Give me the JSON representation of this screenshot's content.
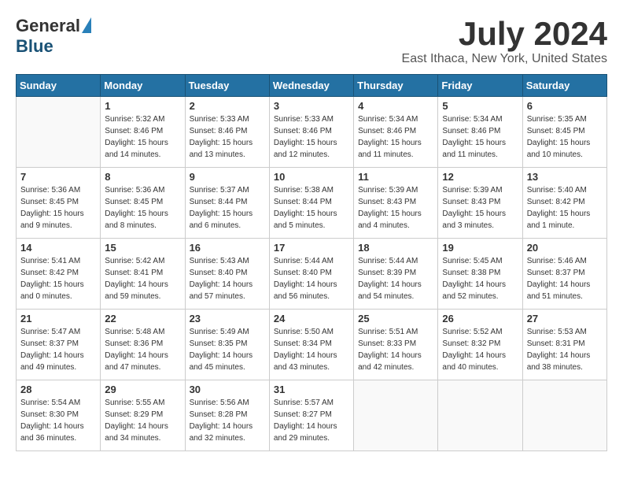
{
  "logo": {
    "general": "General",
    "blue": "Blue"
  },
  "title": "July 2024",
  "location": "East Ithaca, New York, United States",
  "headers": [
    "Sunday",
    "Monday",
    "Tuesday",
    "Wednesday",
    "Thursday",
    "Friday",
    "Saturday"
  ],
  "weeks": [
    [
      {
        "day": "",
        "info": ""
      },
      {
        "day": "1",
        "info": "Sunrise: 5:32 AM\nSunset: 8:46 PM\nDaylight: 15 hours\nand 14 minutes."
      },
      {
        "day": "2",
        "info": "Sunrise: 5:33 AM\nSunset: 8:46 PM\nDaylight: 15 hours\nand 13 minutes."
      },
      {
        "day": "3",
        "info": "Sunrise: 5:33 AM\nSunset: 8:46 PM\nDaylight: 15 hours\nand 12 minutes."
      },
      {
        "day": "4",
        "info": "Sunrise: 5:34 AM\nSunset: 8:46 PM\nDaylight: 15 hours\nand 11 minutes."
      },
      {
        "day": "5",
        "info": "Sunrise: 5:34 AM\nSunset: 8:46 PM\nDaylight: 15 hours\nand 11 minutes."
      },
      {
        "day": "6",
        "info": "Sunrise: 5:35 AM\nSunset: 8:45 PM\nDaylight: 15 hours\nand 10 minutes."
      }
    ],
    [
      {
        "day": "7",
        "info": "Sunrise: 5:36 AM\nSunset: 8:45 PM\nDaylight: 15 hours\nand 9 minutes."
      },
      {
        "day": "8",
        "info": "Sunrise: 5:36 AM\nSunset: 8:45 PM\nDaylight: 15 hours\nand 8 minutes."
      },
      {
        "day": "9",
        "info": "Sunrise: 5:37 AM\nSunset: 8:44 PM\nDaylight: 15 hours\nand 6 minutes."
      },
      {
        "day": "10",
        "info": "Sunrise: 5:38 AM\nSunset: 8:44 PM\nDaylight: 15 hours\nand 5 minutes."
      },
      {
        "day": "11",
        "info": "Sunrise: 5:39 AM\nSunset: 8:43 PM\nDaylight: 15 hours\nand 4 minutes."
      },
      {
        "day": "12",
        "info": "Sunrise: 5:39 AM\nSunset: 8:43 PM\nDaylight: 15 hours\nand 3 minutes."
      },
      {
        "day": "13",
        "info": "Sunrise: 5:40 AM\nSunset: 8:42 PM\nDaylight: 15 hours\nand 1 minute."
      }
    ],
    [
      {
        "day": "14",
        "info": "Sunrise: 5:41 AM\nSunset: 8:42 PM\nDaylight: 15 hours\nand 0 minutes."
      },
      {
        "day": "15",
        "info": "Sunrise: 5:42 AM\nSunset: 8:41 PM\nDaylight: 14 hours\nand 59 minutes."
      },
      {
        "day": "16",
        "info": "Sunrise: 5:43 AM\nSunset: 8:40 PM\nDaylight: 14 hours\nand 57 minutes."
      },
      {
        "day": "17",
        "info": "Sunrise: 5:44 AM\nSunset: 8:40 PM\nDaylight: 14 hours\nand 56 minutes."
      },
      {
        "day": "18",
        "info": "Sunrise: 5:44 AM\nSunset: 8:39 PM\nDaylight: 14 hours\nand 54 minutes."
      },
      {
        "day": "19",
        "info": "Sunrise: 5:45 AM\nSunset: 8:38 PM\nDaylight: 14 hours\nand 52 minutes."
      },
      {
        "day": "20",
        "info": "Sunrise: 5:46 AM\nSunset: 8:37 PM\nDaylight: 14 hours\nand 51 minutes."
      }
    ],
    [
      {
        "day": "21",
        "info": "Sunrise: 5:47 AM\nSunset: 8:37 PM\nDaylight: 14 hours\nand 49 minutes."
      },
      {
        "day": "22",
        "info": "Sunrise: 5:48 AM\nSunset: 8:36 PM\nDaylight: 14 hours\nand 47 minutes."
      },
      {
        "day": "23",
        "info": "Sunrise: 5:49 AM\nSunset: 8:35 PM\nDaylight: 14 hours\nand 45 minutes."
      },
      {
        "day": "24",
        "info": "Sunrise: 5:50 AM\nSunset: 8:34 PM\nDaylight: 14 hours\nand 43 minutes."
      },
      {
        "day": "25",
        "info": "Sunrise: 5:51 AM\nSunset: 8:33 PM\nDaylight: 14 hours\nand 42 minutes."
      },
      {
        "day": "26",
        "info": "Sunrise: 5:52 AM\nSunset: 8:32 PM\nDaylight: 14 hours\nand 40 minutes."
      },
      {
        "day": "27",
        "info": "Sunrise: 5:53 AM\nSunset: 8:31 PM\nDaylight: 14 hours\nand 38 minutes."
      }
    ],
    [
      {
        "day": "28",
        "info": "Sunrise: 5:54 AM\nSunset: 8:30 PM\nDaylight: 14 hours\nand 36 minutes."
      },
      {
        "day": "29",
        "info": "Sunrise: 5:55 AM\nSunset: 8:29 PM\nDaylight: 14 hours\nand 34 minutes."
      },
      {
        "day": "30",
        "info": "Sunrise: 5:56 AM\nSunset: 8:28 PM\nDaylight: 14 hours\nand 32 minutes."
      },
      {
        "day": "31",
        "info": "Sunrise: 5:57 AM\nSunset: 8:27 PM\nDaylight: 14 hours\nand 29 minutes."
      },
      {
        "day": "",
        "info": ""
      },
      {
        "day": "",
        "info": ""
      },
      {
        "day": "",
        "info": ""
      }
    ]
  ]
}
